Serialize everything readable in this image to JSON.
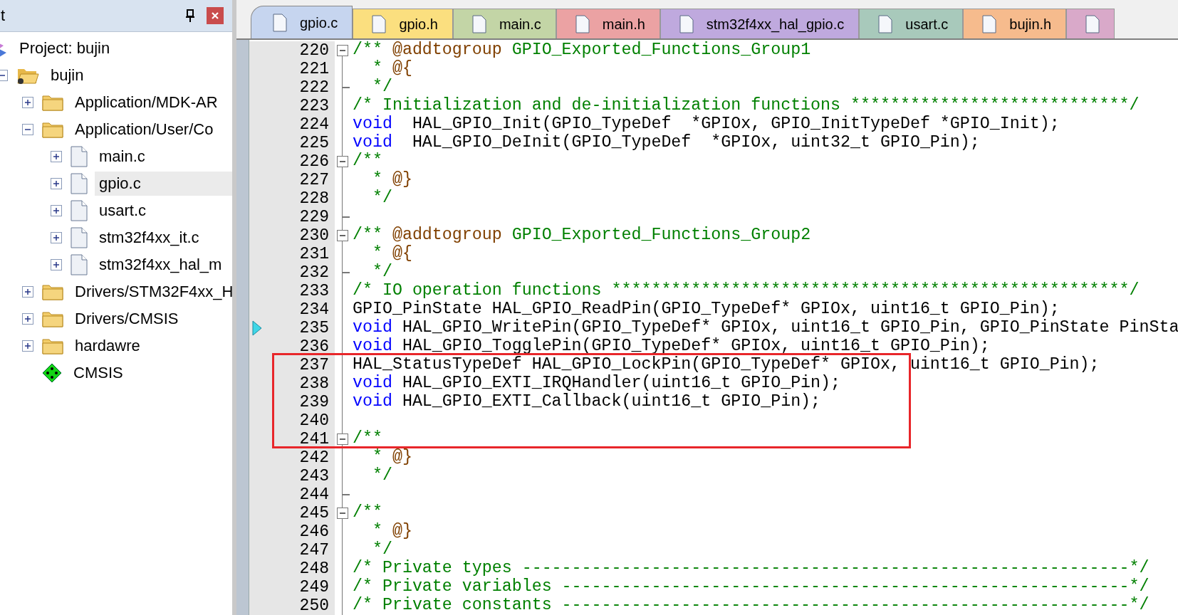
{
  "project_panel": {
    "title": "t",
    "tree": [
      {
        "label": "Project: bujin",
        "kind": "project",
        "selected": false,
        "children": [
          {
            "label": "bujin",
            "kind": "group",
            "expanded": true,
            "selected": false,
            "children": [
              {
                "label": "Application/MDK-AR",
                "kind": "folder",
                "expanded": false,
                "selected": false
              },
              {
                "label": "Application/User/Co",
                "kind": "folder",
                "expanded": true,
                "selected": false,
                "children": [
                  {
                    "label": "main.c",
                    "kind": "file",
                    "expanded": false,
                    "selected": false
                  },
                  {
                    "label": "gpio.c",
                    "kind": "file",
                    "expanded": false,
                    "selected": true
                  },
                  {
                    "label": "usart.c",
                    "kind": "file",
                    "expanded": false,
                    "selected": false
                  },
                  {
                    "label": "stm32f4xx_it.c",
                    "kind": "file",
                    "expanded": false,
                    "selected": false
                  },
                  {
                    "label": "stm32f4xx_hal_m",
                    "kind": "file",
                    "expanded": false,
                    "selected": false
                  }
                ]
              },
              {
                "label": "Drivers/STM32F4xx_H",
                "kind": "folder",
                "expanded": false,
                "selected": false
              },
              {
                "label": "Drivers/CMSIS",
                "kind": "folder",
                "expanded": false,
                "selected": false
              },
              {
                "label": "hardawre",
                "kind": "folder",
                "expanded": false,
                "selected": false
              },
              {
                "label": "CMSIS",
                "kind": "component",
                "selected": false
              }
            ]
          }
        ]
      }
    ]
  },
  "tabs": [
    {
      "label": "gpio.c",
      "color": "#c6d5ef",
      "selected": true
    },
    {
      "label": "gpio.h",
      "color": "#fbdf7f",
      "selected": false
    },
    {
      "label": "main.c",
      "color": "#c3d5a6",
      "selected": false
    },
    {
      "label": "main.h",
      "color": "#eba2a3",
      "selected": false
    },
    {
      "label": "stm32f4xx_hal_gpio.c",
      "color": "#bfa9de",
      "selected": false
    },
    {
      "label": "usart.c",
      "color": "#a8c9bb",
      "selected": false
    },
    {
      "label": "bujin.h",
      "color": "#f6bb8d",
      "selected": false
    },
    {
      "color": "#d9a9c9",
      "selected": false
    }
  ],
  "editor": {
    "lines": [
      {
        "number": "220",
        "kind": "fold-start",
        "tokens": [
          {
            "kind": "comment",
            "text": "/** "
          },
          {
            "kind": "doctag",
            "text": "@addtogroup"
          },
          {
            "kind": "comment",
            "text": " GPIO_Exported_Functions_Group1"
          }
        ]
      },
      {
        "number": "221",
        "tokens": [
          {
            "kind": "comment",
            "text": "  * "
          },
          {
            "kind": "doctag",
            "text": "@{"
          }
        ]
      },
      {
        "number": "222",
        "kind": "fold-end",
        "tokens": [
          {
            "kind": "comment",
            "text": "  */"
          }
        ]
      },
      {
        "number": "223",
        "tokens": [
          {
            "kind": "comment",
            "text": "/* Initialization and de-initialization functions ****************************/"
          }
        ]
      },
      {
        "number": "224",
        "tokens": [
          {
            "kind": "keyword",
            "text": "void"
          },
          {
            "kind": "plain",
            "text": "  HAL_GPIO_Init(GPIO_TypeDef  *GPIOx, GPIO_InitTypeDef *GPIO_Init);"
          }
        ]
      },
      {
        "number": "225",
        "tokens": [
          {
            "kind": "keyword",
            "text": "void"
          },
          {
            "kind": "plain",
            "text": "  HAL_GPIO_DeInit(GPIO_TypeDef  *GPIOx, uint32_t GPIO_Pin);"
          }
        ]
      },
      {
        "number": "226",
        "kind": "fold-start",
        "tokens": [
          {
            "kind": "comment",
            "text": "/**"
          }
        ]
      },
      {
        "number": "227",
        "tokens": [
          {
            "kind": "comment",
            "text": "  * "
          },
          {
            "kind": "doctag",
            "text": "@}"
          }
        ]
      },
      {
        "number": "228",
        "tokens": [
          {
            "kind": "comment",
            "text": "  */"
          }
        ]
      },
      {
        "number": "229",
        "kind": "fold-end"
      },
      {
        "number": "230",
        "kind": "fold-start",
        "tokens": [
          {
            "kind": "comment",
            "text": "/** "
          },
          {
            "kind": "doctag",
            "text": "@addtogroup"
          },
          {
            "kind": "comment",
            "text": " GPIO_Exported_Functions_Group2"
          }
        ]
      },
      {
        "number": "231",
        "tokens": [
          {
            "kind": "comment",
            "text": "  * "
          },
          {
            "kind": "doctag",
            "text": "@{"
          }
        ]
      },
      {
        "number": "232",
        "kind": "fold-end",
        "tokens": [
          {
            "kind": "comment",
            "text": "  */"
          }
        ]
      },
      {
        "number": "233",
        "tokens": [
          {
            "kind": "comment",
            "text": "/* IO operation functions ****************************************************/"
          }
        ]
      },
      {
        "number": "234",
        "tokens": [
          {
            "kind": "plain",
            "text": "GPIO_PinState HAL_GPIO_ReadPin(GPIO_TypeDef* GPIOx, uint16_t GPIO_Pin);"
          }
        ]
      },
      {
        "number": "235",
        "current": true,
        "tokens": [
          {
            "kind": "keyword",
            "text": "void"
          },
          {
            "kind": "plain",
            "text": " HAL_GPIO_WritePin(GPIO_TypeDef* GPIOx, uint16_t GPIO_Pin, GPIO_PinState PinSta"
          }
        ]
      },
      {
        "number": "236",
        "tokens": [
          {
            "kind": "keyword",
            "text": "void"
          },
          {
            "kind": "plain",
            "text": " HAL_GPIO_TogglePin(GPIO_TypeDef* GPIOx, uint16_t GPIO_Pin);"
          }
        ]
      },
      {
        "number": "237",
        "tokens": [
          {
            "kind": "plain",
            "text": "HAL_StatusTypeDef HAL_GPIO_LockPin(GPIO_TypeDef* GPIOx, uint16_t GPIO_Pin);"
          }
        ]
      },
      {
        "number": "238",
        "tokens": [
          {
            "kind": "keyword",
            "text": "void"
          },
          {
            "kind": "plain",
            "text": " HAL_GPIO_EXTI_IRQHandler(uint16_t GPIO_Pin);"
          }
        ]
      },
      {
        "number": "239",
        "tokens": [
          {
            "kind": "keyword",
            "text": "void"
          },
          {
            "kind": "plain",
            "text": " HAL_GPIO_EXTI_Callback(uint16_t GPIO_Pin);"
          }
        ]
      },
      {
        "number": "240"
      },
      {
        "number": "241",
        "kind": "fold-start",
        "tokens": [
          {
            "kind": "comment",
            "text": "/**"
          }
        ]
      },
      {
        "number": "242",
        "tokens": [
          {
            "kind": "comment",
            "text": "  * "
          },
          {
            "kind": "doctag",
            "text": "@}"
          }
        ]
      },
      {
        "number": "243",
        "tokens": [
          {
            "kind": "comment",
            "text": "  */"
          }
        ]
      },
      {
        "number": "244",
        "kind": "fold-end"
      },
      {
        "number": "245",
        "kind": "fold-start",
        "tokens": [
          {
            "kind": "comment",
            "text": "/**"
          }
        ]
      },
      {
        "number": "246",
        "tokens": [
          {
            "kind": "comment",
            "text": "  * "
          },
          {
            "kind": "doctag",
            "text": "@}"
          }
        ]
      },
      {
        "number": "247",
        "tokens": [
          {
            "kind": "comment",
            "text": "  */"
          }
        ]
      },
      {
        "number": "248",
        "tokens": [
          {
            "kind": "comment",
            "text": "/* Private types -------------------------------------------------------------*/"
          }
        ]
      },
      {
        "number": "249",
        "tokens": [
          {
            "kind": "comment",
            "text": "/* Private variables ---------------------------------------------------------*/"
          }
        ]
      },
      {
        "number": "250",
        "tokens": [
          {
            "kind": "comment",
            "text": "/* Private constants ---------------------------------------------------------*/"
          }
        ]
      }
    ]
  }
}
